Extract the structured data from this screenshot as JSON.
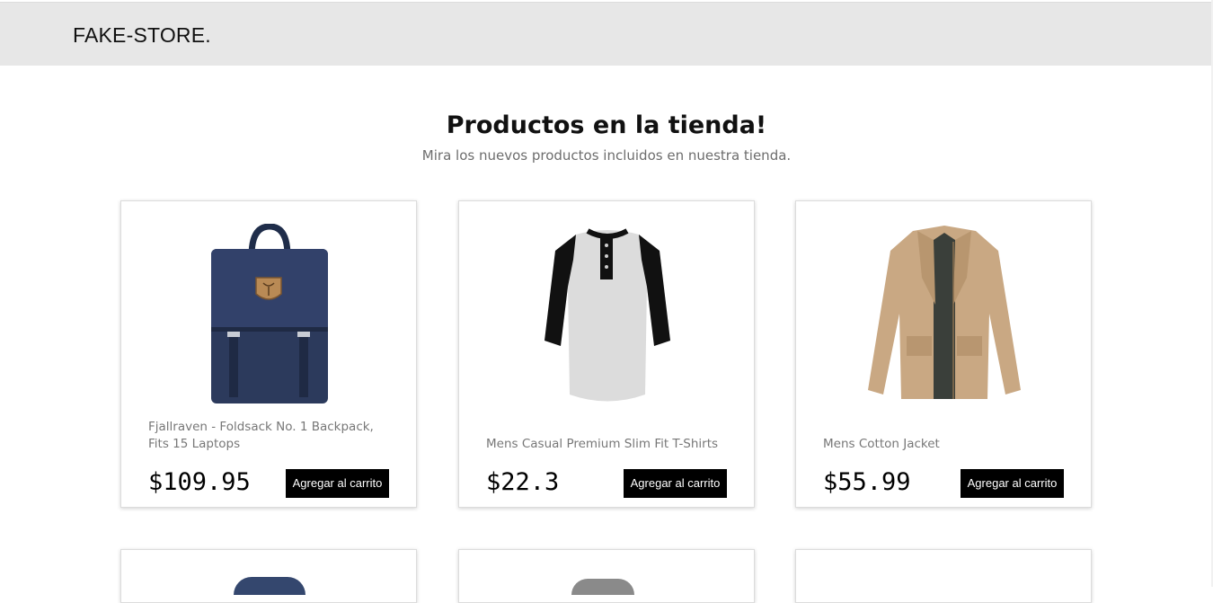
{
  "header": {
    "brand": "FAKE-STORE."
  },
  "hero": {
    "title": "Productos en la tienda!",
    "subtitle": "Mira los nuevos productos incluidos en nuestra tienda."
  },
  "products": [
    {
      "name": "Fjallraven - Foldsack No. 1 Backpack, Fits 15 Laptops",
      "price": "$109.95",
      "button": "Agregar al carrito",
      "image": "backpack-image"
    },
    {
      "name": "Mens Casual Premium Slim Fit T-Shirts",
      "price": "$22.3",
      "button": "Agregar al carrito",
      "image": "tshirt-image"
    },
    {
      "name": "Mens Cotton Jacket",
      "price": "$55.99",
      "button": "Agregar al carrito",
      "image": "jacket-image"
    }
  ],
  "colors": {
    "header_bg": "#e7e7e7",
    "button_bg": "#000000",
    "subtitle": "#6d6d6d",
    "product_name": "#777777"
  }
}
